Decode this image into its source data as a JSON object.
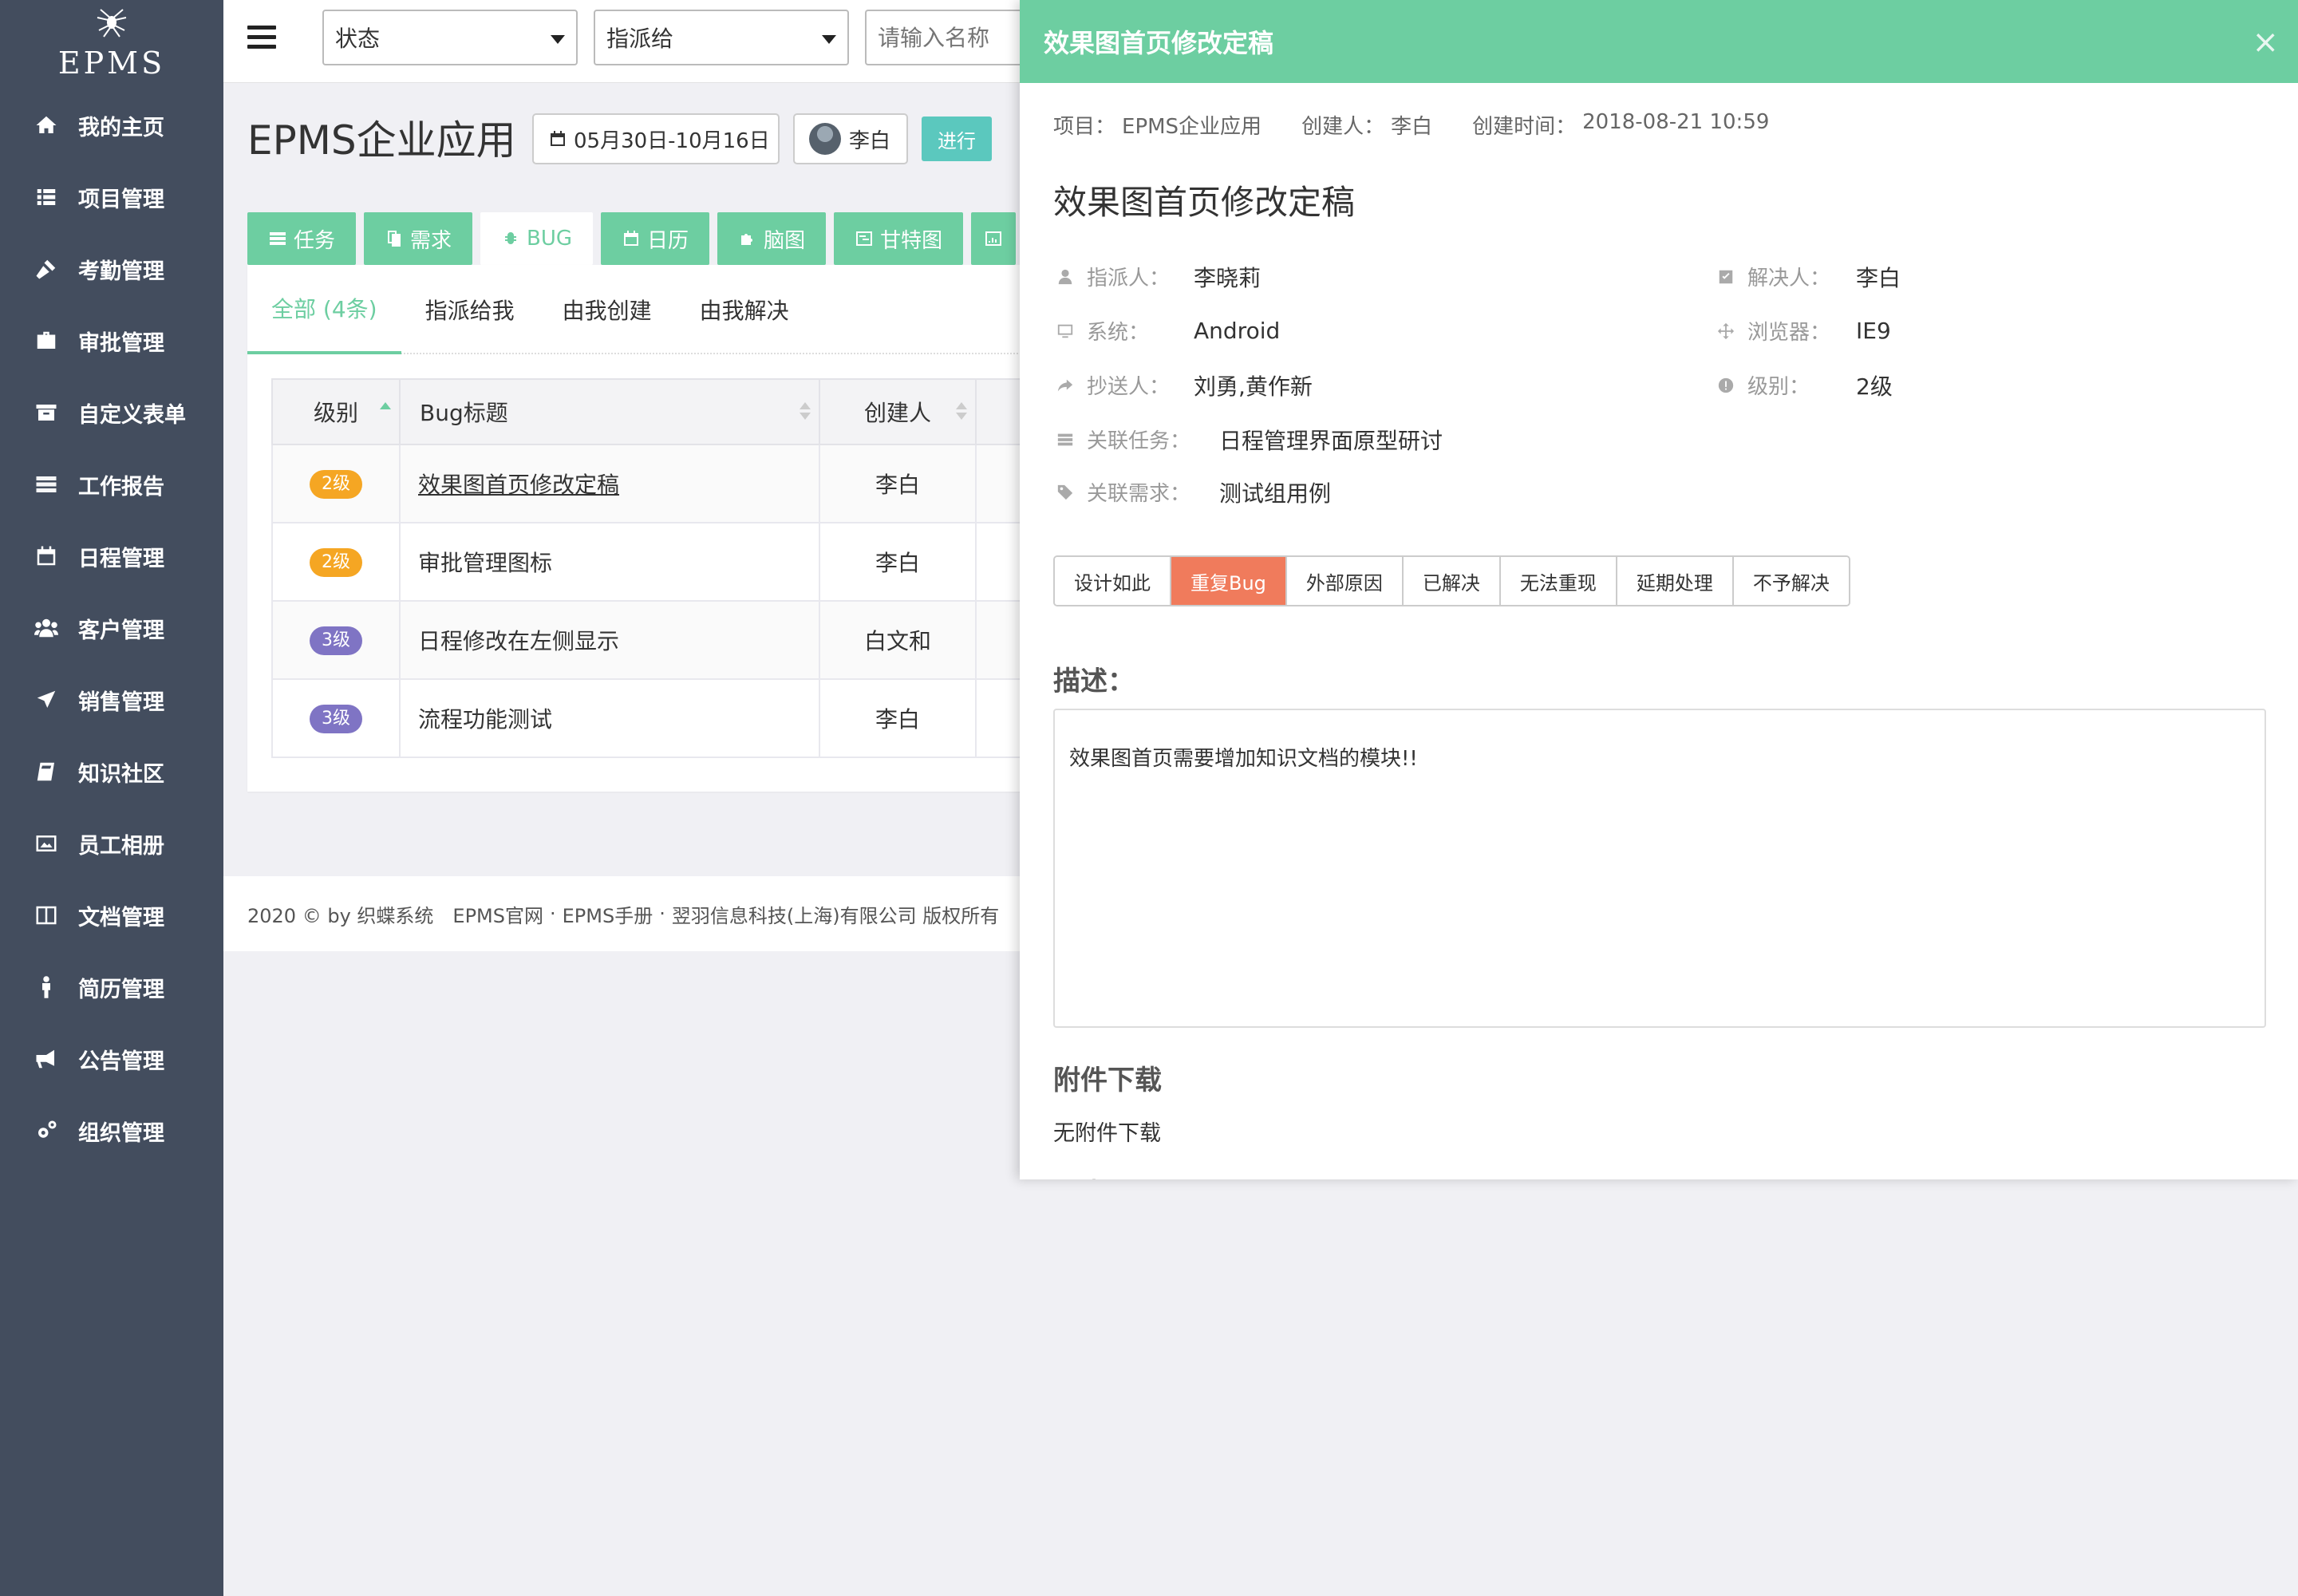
{
  "sidebar": {
    "brand": "EPMS",
    "items": [
      {
        "label": "我的主页",
        "icon": "home-icon"
      },
      {
        "label": "项目管理",
        "icon": "list-icon"
      },
      {
        "label": "考勤管理",
        "icon": "gavel-icon"
      },
      {
        "label": "审批管理",
        "icon": "briefcase-icon"
      },
      {
        "label": "自定义表单",
        "icon": "archive-icon"
      },
      {
        "label": "工作报告",
        "icon": "tasks-icon"
      },
      {
        "label": "日程管理",
        "icon": "calendar-icon"
      },
      {
        "label": "客户管理",
        "icon": "users-icon"
      },
      {
        "label": "销售管理",
        "icon": "plane-icon"
      },
      {
        "label": "知识社区",
        "icon": "book-icon"
      },
      {
        "label": "员工相册",
        "icon": "picture-icon"
      },
      {
        "label": "文档管理",
        "icon": "columns-icon"
      },
      {
        "label": "简历管理",
        "icon": "person-icon"
      },
      {
        "label": "公告管理",
        "icon": "bullhorn-icon"
      },
      {
        "label": "组织管理",
        "icon": "cogs-icon"
      }
    ]
  },
  "topbar": {
    "status_select": "状态",
    "assign_select": "指派给",
    "search_placeholder": "请输入名称"
  },
  "project": {
    "title": "EPMS企业应用",
    "date_range": "05月30日-10月16日",
    "user": "李白",
    "status": "进行"
  },
  "tabs": [
    {
      "label": "任务",
      "icon": "tasks-icon",
      "active": false
    },
    {
      "label": "需求",
      "icon": "copy-icon",
      "active": false
    },
    {
      "label": "BUG",
      "icon": "bug-icon",
      "active": true
    },
    {
      "label": "日历",
      "icon": "calendar-icon",
      "active": false
    },
    {
      "label": "脑图",
      "icon": "puzzle-icon",
      "active": false
    },
    {
      "label": "甘特图",
      "icon": "gantt-icon",
      "active": false
    }
  ],
  "subtabs": [
    "全部 (4条)",
    "指派给我",
    "由我创建",
    "由我解决"
  ],
  "table": {
    "headers": {
      "level": "级别",
      "title": "Bug标题",
      "creator": "创建人"
    },
    "rows": [
      {
        "level": "2级",
        "level_color": "#f5a623",
        "title": "效果图首页修改定稿",
        "creator": "李白",
        "link": true
      },
      {
        "level": "2级",
        "level_color": "#f5a623",
        "title": "审批管理图标",
        "creator": "李白",
        "link": false
      },
      {
        "level": "3级",
        "level_color": "#7f74c4",
        "title": "日程修改在左侧显示",
        "creator": "白文和",
        "link": false
      },
      {
        "level": "3级",
        "level_color": "#7f74c4",
        "title": "流程功能测试",
        "creator": "李白",
        "link": false
      }
    ]
  },
  "footer": {
    "copyright": "2020 © by 织蝶系统",
    "link1": "EPMS官网",
    "sep": "·",
    "link2": "EPMS手册",
    "company": "翌羽信息科技(上海)有限公司 版权所有"
  },
  "drawer": {
    "header_title": "效果图首页修改定稿",
    "close": "×",
    "meta": {
      "project_label": "项目：",
      "project": "EPMS企业应用",
      "creator_label": "创建人：",
      "creator": "李白",
      "time_label": "创建时间：",
      "time": "2018-08-21 10:59"
    },
    "title": "效果图首页修改定稿",
    "fields": {
      "assignee_label": "指派人：",
      "assignee": "李晓莉",
      "resolver_label": "解决人：",
      "resolver": "李白",
      "system_label": "系统：",
      "system": "Android",
      "browser_label": "浏览器：",
      "browser": "IE9",
      "cc_label": "抄送人：",
      "cc": "刘勇,黄作新",
      "level_label": "级别：",
      "level": "2级",
      "task_label": "关联任务：",
      "task": "日程管理界面原型研讨",
      "req_label": "关联需求：",
      "req": "测试组用例"
    },
    "actions": [
      "设计如此",
      "重复Bug",
      "外部原因",
      "已解决",
      "无法重现",
      "延期处理",
      "不予解决"
    ],
    "active_action": "重复Bug",
    "desc_heading": "描述：",
    "desc": "效果图首页需要增加知识文档的模块!!",
    "attach_heading": "附件下载",
    "attach_none": "无附件下载",
    "history_heading": "历史记录"
  },
  "colors": {
    "accent": "#6dcea1",
    "sidebar": "#434d5e",
    "danger": "#f07b5c",
    "status": "#5bc8be"
  }
}
